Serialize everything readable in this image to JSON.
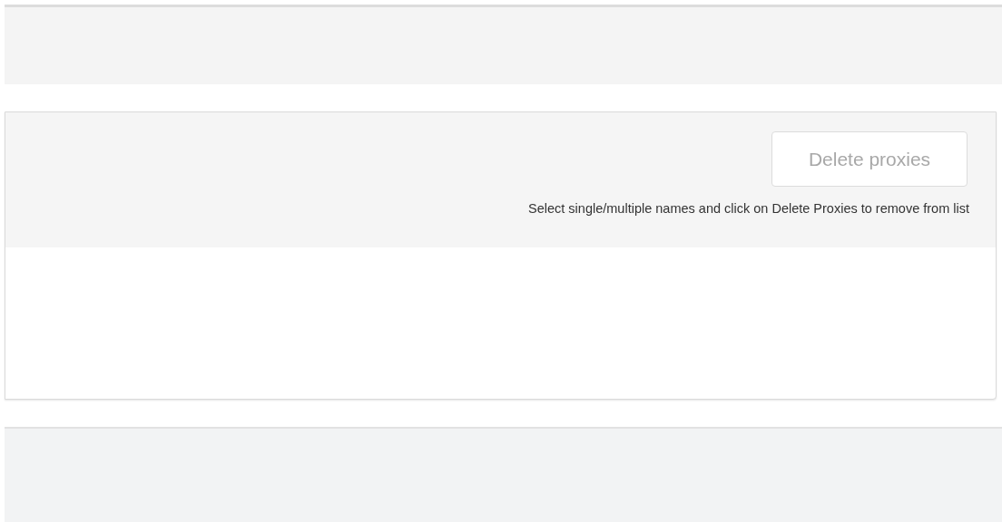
{
  "panel": {
    "delete_button": {
      "label": "Delete proxies",
      "disabled": true
    },
    "hint": "Select single/multiple names and click on Delete Proxies to remove from list"
  }
}
